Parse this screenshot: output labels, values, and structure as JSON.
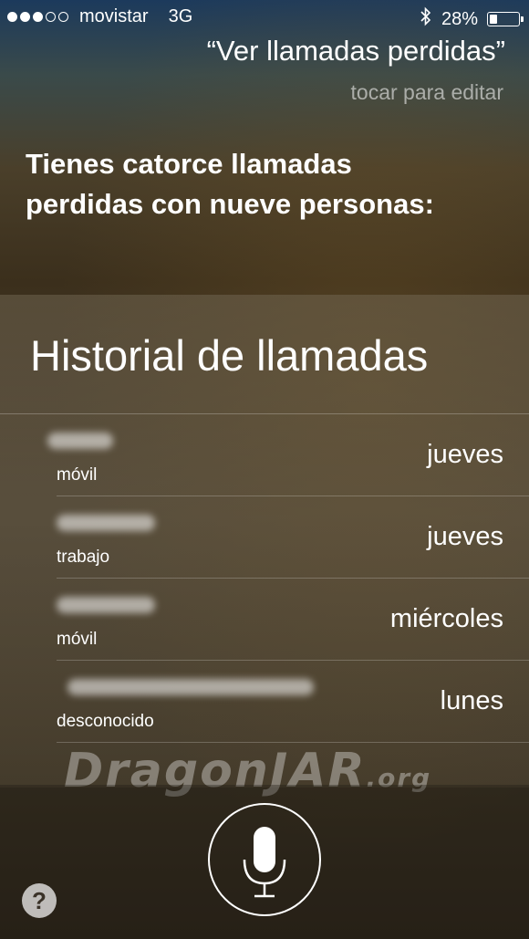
{
  "status_bar": {
    "signal_strength": 3,
    "signal_max": 5,
    "carrier": "movistar",
    "network": "3G",
    "bluetooth_icon": "bluetooth-icon",
    "battery_percent": "28%",
    "battery_level": 0.28
  },
  "siri": {
    "query": "“Ver llamadas perdidas”",
    "tap_to_edit": "tocar para editar",
    "response": "Tienes catorce llamadas perdidas con nueve personas:"
  },
  "call_history": {
    "title": "Historial de llamadas",
    "calls": [
      {
        "type": "móvil",
        "day": "jueves"
      },
      {
        "type": "trabajo",
        "day": "jueves"
      },
      {
        "type": "móvil",
        "day": "miércoles"
      },
      {
        "type": "desconocido",
        "day": "lunes"
      }
    ]
  },
  "watermark": {
    "text": "DragonJAR",
    "suffix": ".org"
  },
  "controls": {
    "mic_icon": "microphone-icon",
    "help_label": "?"
  }
}
